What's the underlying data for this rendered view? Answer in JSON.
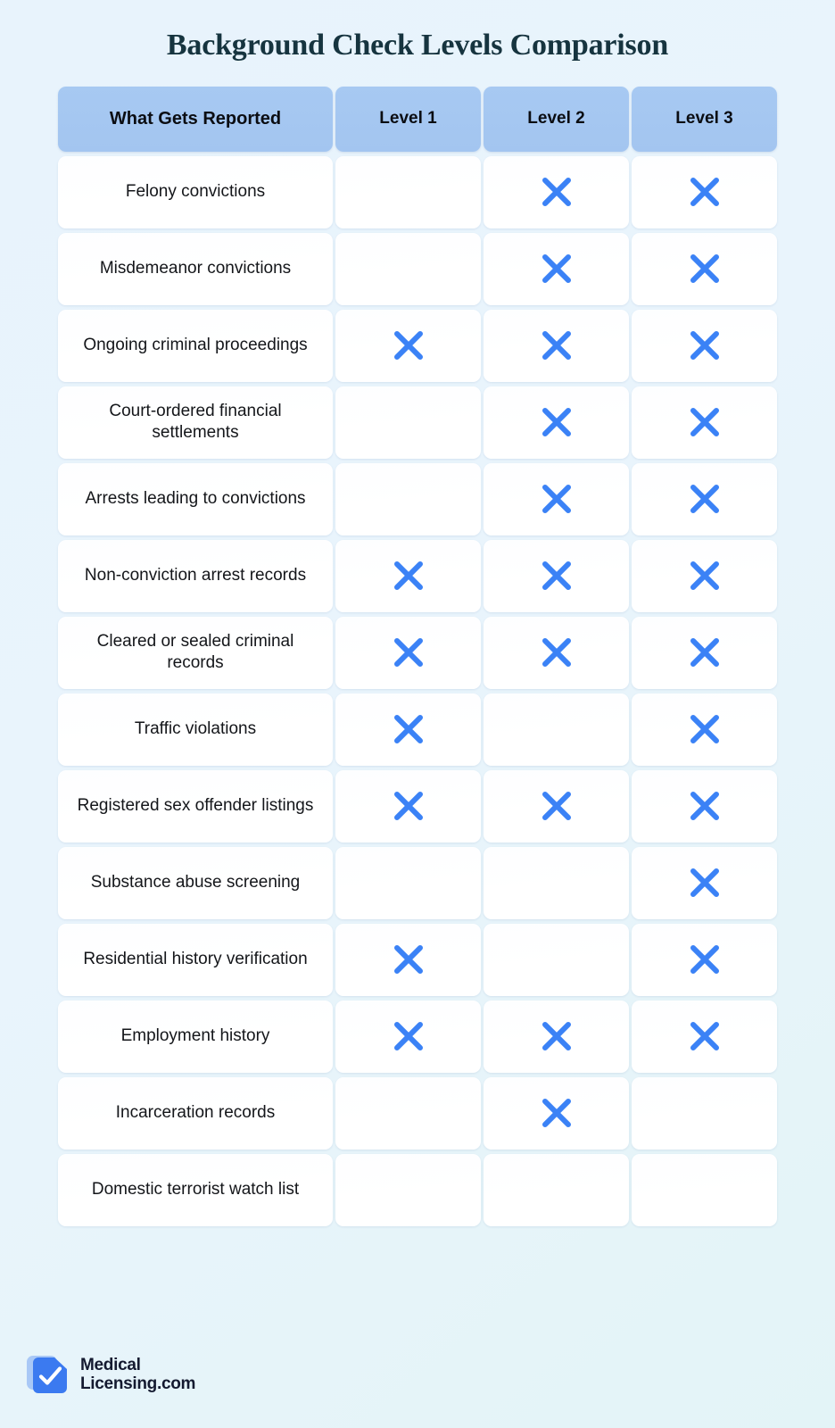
{
  "page": {
    "title": "Background Check Levels Comparison",
    "background_color": "#e8f3fc",
    "title_color": "#16343f",
    "accent_color": "#3b82f6",
    "header_color": "#a7c9f2"
  },
  "table": {
    "headers": [
      "What Gets Reported",
      "Level 1",
      "Level 2",
      "Level 3"
    ],
    "mark_icon": "x-mark-icon",
    "rows": [
      {
        "label": "Felony convictions",
        "marks": [
          false,
          true,
          true
        ]
      },
      {
        "label": "Misdemeanor convictions",
        "marks": [
          false,
          true,
          true
        ]
      },
      {
        "label": "Ongoing criminal proceedings",
        "marks": [
          true,
          true,
          true
        ]
      },
      {
        "label": "Court-ordered financial settlements",
        "marks": [
          false,
          true,
          true
        ]
      },
      {
        "label": "Arrests leading to convictions",
        "marks": [
          false,
          true,
          true
        ]
      },
      {
        "label": "Non-conviction arrest records",
        "marks": [
          true,
          true,
          true
        ]
      },
      {
        "label": "Cleared or sealed criminal records",
        "marks": [
          true,
          true,
          true
        ]
      },
      {
        "label": "Traffic violations",
        "marks": [
          true,
          false,
          true
        ]
      },
      {
        "label": "Registered sex offender listings",
        "marks": [
          true,
          true,
          true
        ]
      },
      {
        "label": "Substance abuse screening",
        "marks": [
          false,
          false,
          true
        ]
      },
      {
        "label": "Residential history verification",
        "marks": [
          true,
          false,
          true
        ]
      },
      {
        "label": "Employment history",
        "marks": [
          true,
          true,
          true
        ]
      },
      {
        "label": "Incarceration records",
        "marks": [
          false,
          true,
          false
        ]
      },
      {
        "label": "Domestic terrorist watch list",
        "marks": [
          false,
          false,
          false
        ]
      }
    ]
  },
  "footer": {
    "logo_icon": "document-check-icon",
    "brand_line1": "Medical",
    "brand_line2": "Licensing.com"
  }
}
